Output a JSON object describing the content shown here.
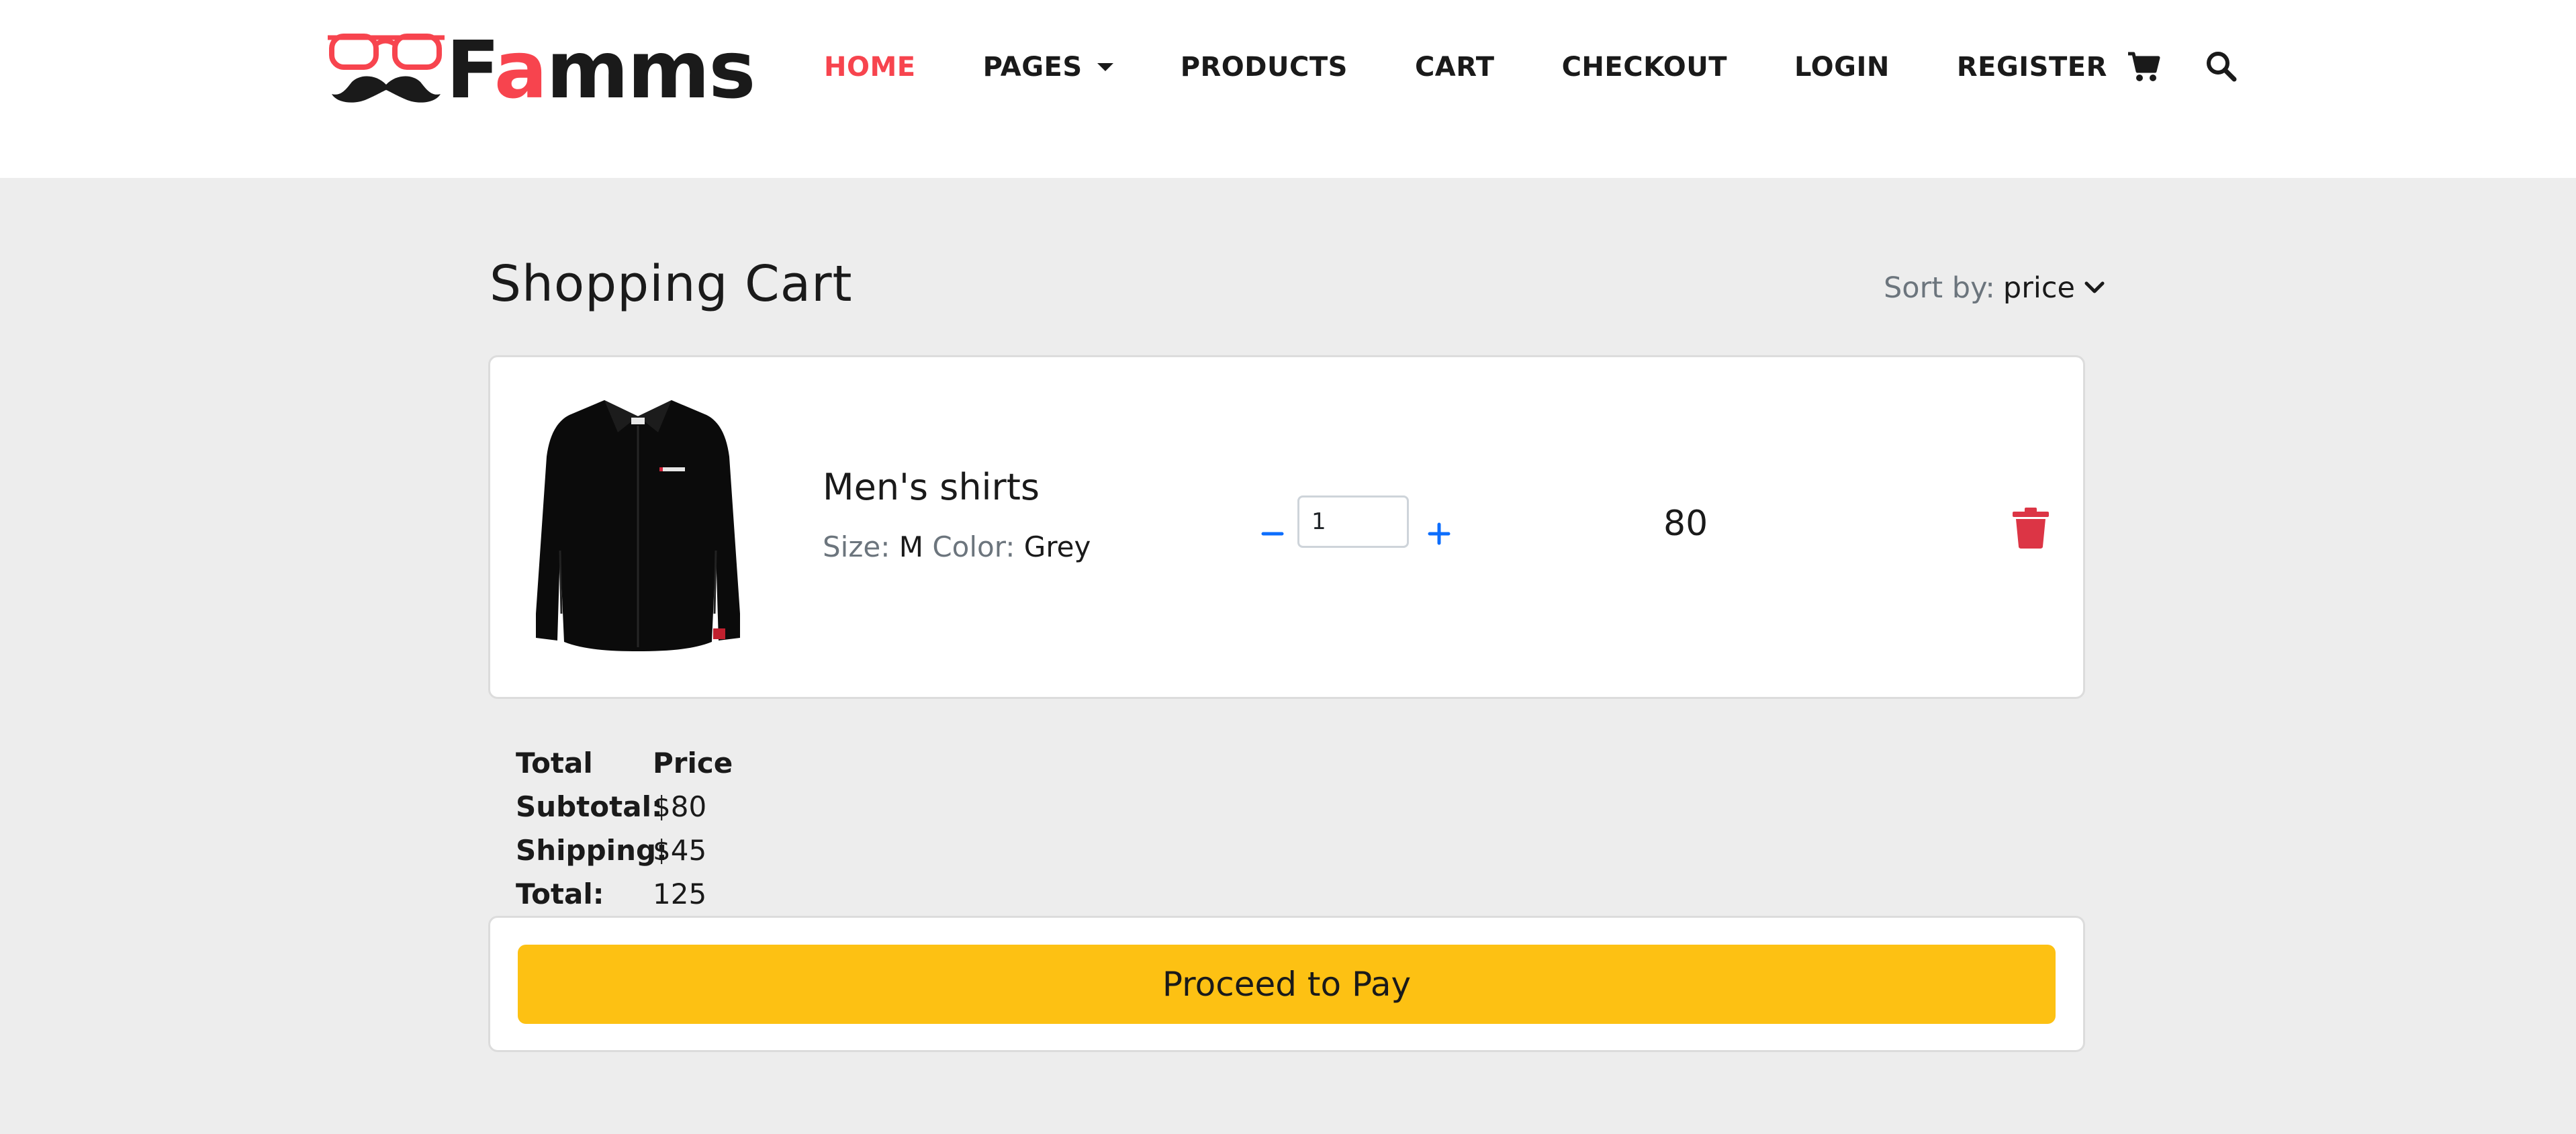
{
  "brand": {
    "name_part1": "F",
    "name_accent": "a",
    "name_part2": "mms",
    "accent_color": "#f7444e"
  },
  "nav": {
    "items": [
      {
        "label": "HOME",
        "active": true
      },
      {
        "label": "PAGES",
        "dropdown": true
      },
      {
        "label": "PRODUCTS"
      },
      {
        "label": "CART"
      },
      {
        "label": "CHECKOUT"
      },
      {
        "label": "LOGIN"
      },
      {
        "label": "REGISTER"
      }
    ],
    "icons": [
      "cart-icon",
      "search-icon"
    ]
  },
  "cart": {
    "title": "Shopping Cart",
    "sort_label": "Sort by:",
    "sort_value": "price",
    "items": [
      {
        "name": "Men's shirts",
        "size_label": "Size:",
        "size": "M",
        "color_label": "Color:",
        "color": "Grey",
        "quantity": "1",
        "price": "80"
      }
    ]
  },
  "summary": {
    "header_left": "Total",
    "header_right": "Price",
    "subtotal_label": "Subtotal:",
    "subtotal": "$80",
    "shipping_label": "Shipping:",
    "shipping": "$45",
    "total_label": "Total:",
    "total": "125"
  },
  "checkout": {
    "button_label": "Proceed to Pay",
    "button_color": "#fdc113"
  },
  "colors": {
    "qty_controls": "#0d6efd",
    "delete": "#dc3545",
    "page_bg": "#ededed"
  }
}
